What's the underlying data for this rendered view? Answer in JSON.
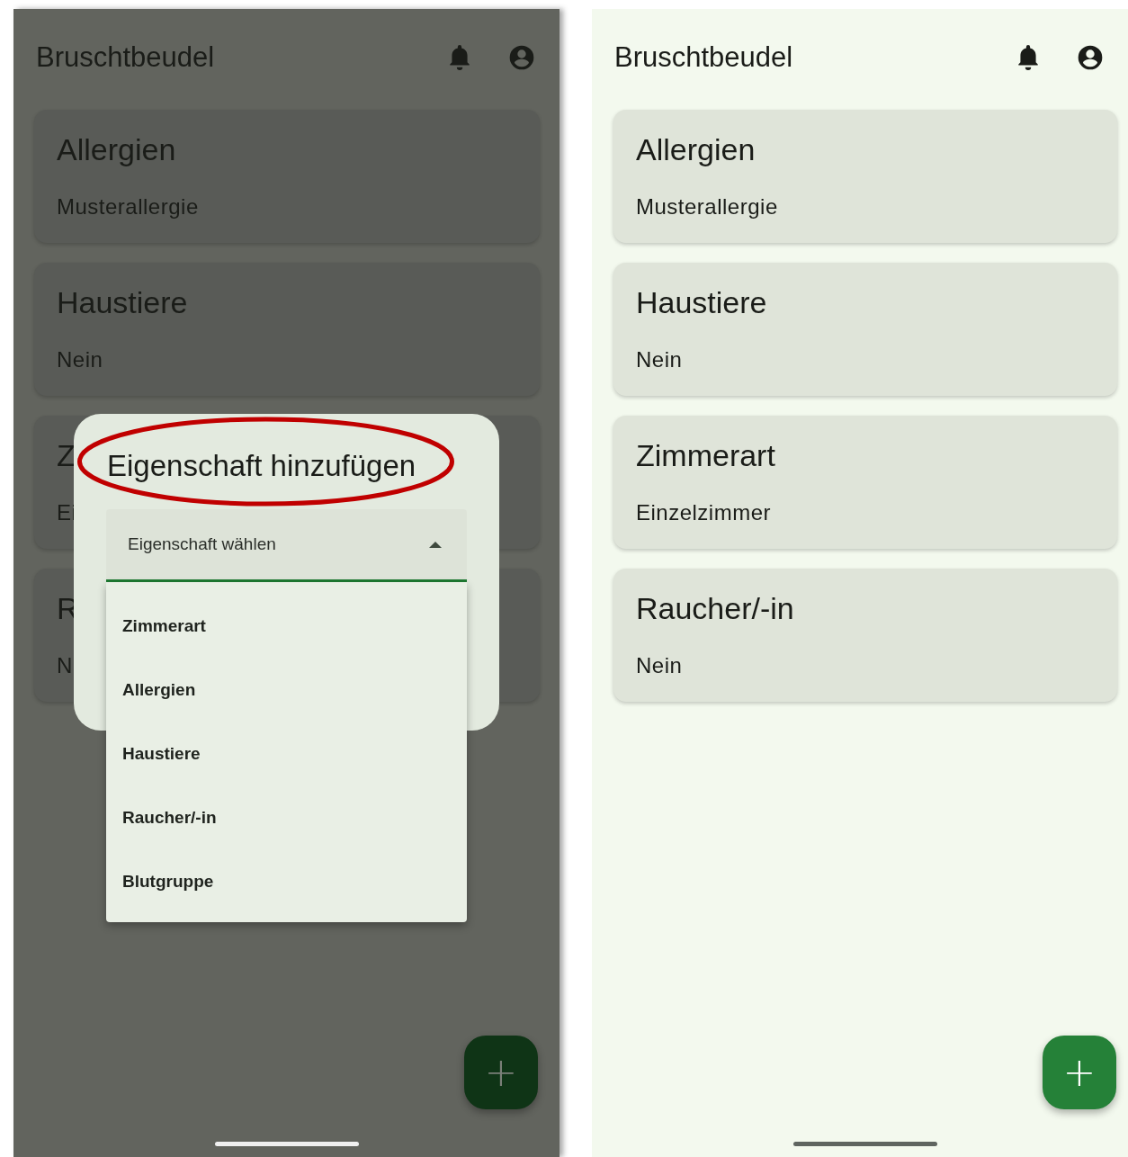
{
  "screens": [
    {
      "dimmed": true,
      "app_bar": {
        "title": "Bruschtbeudel"
      },
      "cards": [
        {
          "title": "Allergien",
          "value": "Musterallergie"
        },
        {
          "title": "Haustiere",
          "value": "Nein"
        },
        {
          "title": "Z",
          "value": "Ei"
        },
        {
          "title": "R",
          "value": "N"
        }
      ],
      "fab": {
        "label": "+"
      },
      "dialog": {
        "title": "Eigenschaft hinzufügen",
        "select": {
          "placeholder": "Eigenschaft wählen",
          "expanded": true,
          "options": [
            "Zimmerart",
            "Allergien",
            "Haustiere",
            "Raucher/-in",
            "Blutgruppe"
          ]
        }
      }
    },
    {
      "dimmed": false,
      "app_bar": {
        "title": "Bruschtbeudel"
      },
      "cards": [
        {
          "title": "Allergien",
          "value": "Musterallergie"
        },
        {
          "title": "Haustiere",
          "value": "Nein"
        },
        {
          "title": "Zimmerart",
          "value": "Einzelzimmer"
        },
        {
          "title": "Raucher/-in",
          "value": "Nein"
        }
      ],
      "fab": {
        "label": "+"
      }
    }
  ]
}
